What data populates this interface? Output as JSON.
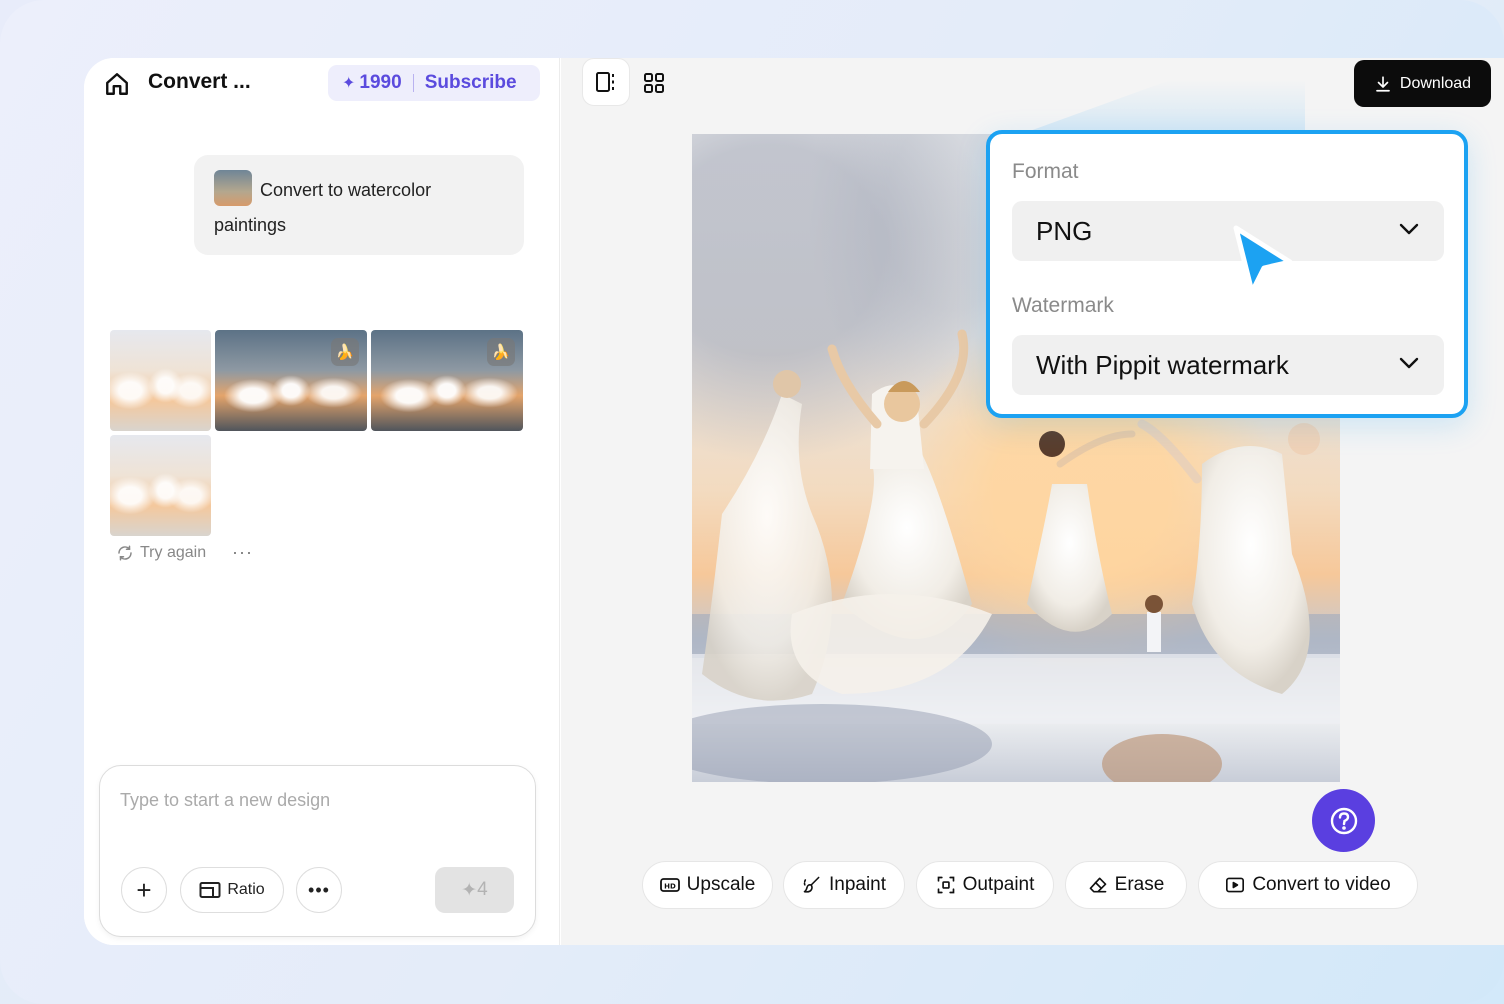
{
  "header": {
    "title": "Convert ...",
    "credits": "1990",
    "subscribe_label": "Subscribe"
  },
  "chat": {
    "prompt_text": "Convert to watercolor paintings"
  },
  "results": {
    "try_again_label": "Try again",
    "more_label": "···"
  },
  "composer": {
    "placeholder": "Type to start a new design",
    "ratio_label": "Ratio",
    "send_cost": "4"
  },
  "canvas": {
    "download_label": "Download"
  },
  "tools": [
    {
      "label": "Upscale"
    },
    {
      "label": "Inpaint"
    },
    {
      "label": "Outpaint"
    },
    {
      "label": "Erase"
    },
    {
      "label": "Convert to video"
    }
  ],
  "download_popover": {
    "format_label": "Format",
    "format_value": "PNG",
    "watermark_label": "Watermark",
    "watermark_value": "With Pippit watermark"
  },
  "colors": {
    "accent": "#5a3fe0",
    "highlight_border": "#1ca2f2",
    "cursor": "#1ca2f2"
  }
}
